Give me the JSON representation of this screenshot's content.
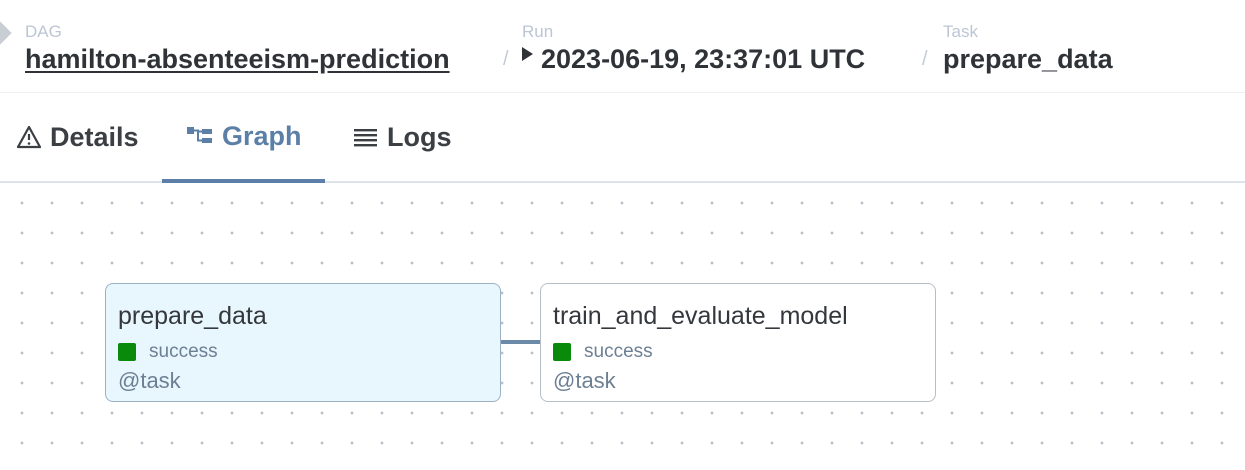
{
  "breadcrumb": {
    "dag": {
      "label": "DAG",
      "value": "hamilton-absenteeism-prediction"
    },
    "run": {
      "label": "Run",
      "value": "2023-06-19, 23:37:01 UTC"
    },
    "task": {
      "label": "Task",
      "value": "prepare_data"
    },
    "separator": "/"
  },
  "tabs": [
    {
      "label": "Details",
      "icon": "warning-triangle-icon",
      "active": false
    },
    {
      "label": "Graph",
      "icon": "graph-icon",
      "active": true
    },
    {
      "label": "Logs",
      "icon": "list-lines-icon",
      "active": false
    }
  ],
  "graph": {
    "nodes": [
      {
        "name": "prepare_data",
        "status": "success",
        "operator": "@task",
        "selected": true,
        "status_color": "#0a8a0a"
      },
      {
        "name": "train_and_evaluate_model",
        "status": "success",
        "operator": "@task",
        "selected": false,
        "status_color": "#0a8a0a"
      }
    ],
    "edges": [
      {
        "from": "prepare_data",
        "to": "train_and_evaluate_model"
      }
    ]
  },
  "colors": {
    "accent": "#5b7fa6",
    "success": "#0a8a0a",
    "selected_node_bg": "#e8f6fd"
  }
}
